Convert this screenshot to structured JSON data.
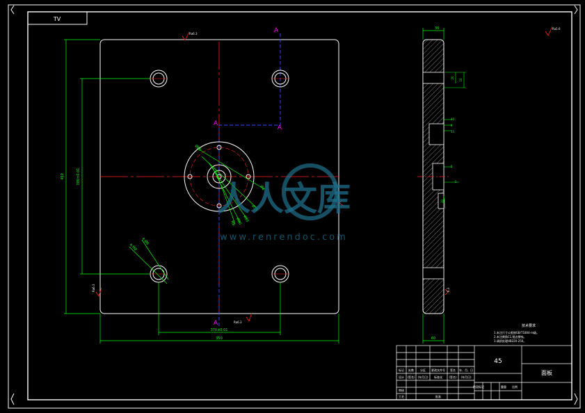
{
  "sheet": {
    "view_label": "TV"
  },
  "front_view": {
    "section_top": "A",
    "section_mid_left": "A",
    "section_mid_right": "A",
    "section_bottom": "A",
    "width_dim": "350",
    "height_dim": "450",
    "hole_spacing_v": "380±0.01",
    "hole_spacing_h": "370±0.01",
    "roughness": "Ra6.3",
    "diag_dims": [
      "Ø8",
      "Ø15",
      "Ø35",
      "Ø80",
      "Ø60",
      "M8"
    ],
    "corner_dims": [
      "4-M8",
      "4-Ø8"
    ]
  },
  "side_view": {
    "top_dim": "30",
    "right_dims": [
      "10",
      "20",
      "40",
      "8",
      "15",
      "5",
      "5",
      "10"
    ],
    "bottom_dim": "60",
    "roughness_top": "Ra1.6",
    "roughness_right": "6.3"
  },
  "tech_req": {
    "title": "技术要求",
    "lines": [
      "1.未注尺寸公差按GB/T1804-m级。",
      "2.未注倒角C1,锐边倒钝。",
      "3.调质处理HB220-250。"
    ]
  },
  "title_block": {
    "material": "45",
    "part_name": "面板",
    "row_headers": [
      "标记",
      "处数",
      "分区",
      "更改文件号",
      "签名",
      "年、月、日"
    ],
    "row2": [
      "设计",
      "(签名)",
      "(年月日)",
      "标准化",
      "(签名)",
      "(年月日)"
    ],
    "row3": [
      "审核",
      "",
      "",
      "",
      "",
      ""
    ],
    "row4": [
      "工艺",
      "",
      "",
      "批准",
      "",
      ""
    ],
    "stage_headers": [
      "阶段标记",
      "重量",
      "比例"
    ]
  },
  "watermark": {
    "brand": "人人文库",
    "url": "www.renrendoc.com"
  }
}
